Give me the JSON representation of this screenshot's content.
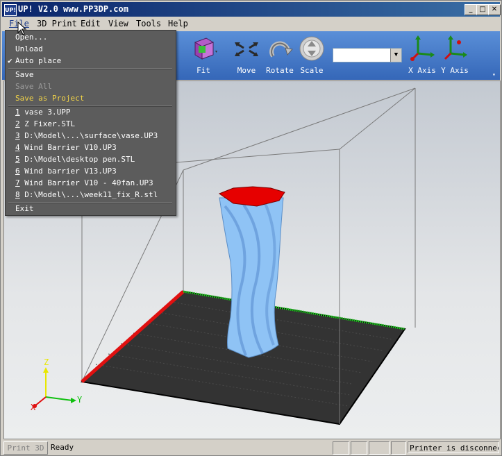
{
  "window": {
    "title": "UP!   V2.0 www.PP3DP.com",
    "app_icon": "UP!",
    "min_glyph": "_",
    "max_glyph": "□",
    "close_glyph": "✕"
  },
  "menubar": [
    "File",
    "3D Print",
    "Edit",
    "View",
    "Tools",
    "Help"
  ],
  "toolbar": {
    "fit": "Fit",
    "move": "Move",
    "rotate": "Rotate",
    "scale": "Scale",
    "x_axis": "X Axis",
    "y_axis": "Y Axis",
    "combo_value": ""
  },
  "file_menu": {
    "open": "Open...",
    "unload": "Unload",
    "auto_place": "Auto place",
    "auto_place_checked": true,
    "save": "Save",
    "save_all": "Save All",
    "save_as_project": "Save as Project",
    "recent": [
      {
        "num": "1",
        "name": "vase 3.UPP"
      },
      {
        "num": "2",
        "name": "Z Fixer.STL"
      },
      {
        "num": "3",
        "name": "D:\\Model\\...\\surface\\vase.UP3"
      },
      {
        "num": "4",
        "name": "Wind Barrier V10.UP3"
      },
      {
        "num": "5",
        "name": "D:\\Model\\desktop pen.STL"
      },
      {
        "num": "6",
        "name": "Wind barrier V13.UP3"
      },
      {
        "num": "7",
        "name": "Wind Barrier V10 - 40fan.UP3"
      },
      {
        "num": "8",
        "name": "D:\\Model\\...\\week11_fix_R.stl"
      }
    ],
    "exit": "Exit"
  },
  "axes": {
    "x": "X",
    "y": "Y",
    "z": "Z"
  },
  "status": {
    "print_button": "Print 3D",
    "text": "Ready",
    "printer": "Printer is disconnected"
  },
  "colors": {
    "toolbar": "#3f74c4",
    "platform": "#333333",
    "model": "#8fc3f5",
    "model_top": "#e60000",
    "menu_bg": "#5c5c5c",
    "menu_highlight": "#f2d448"
  }
}
